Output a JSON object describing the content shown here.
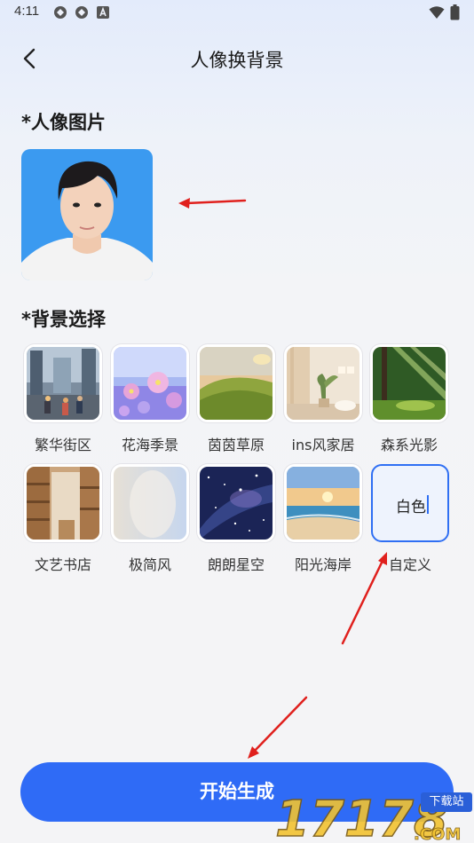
{
  "status_bar": {
    "time": "4:11",
    "icons": [
      "app-icon-1",
      "app-icon-2",
      "a-badge-icon",
      "wifi-icon",
      "battery-icon"
    ]
  },
  "header": {
    "title": "人像换背景",
    "back_icon": "chevron-left-icon"
  },
  "portrait_section": {
    "title": "*人像图片"
  },
  "background_section": {
    "title": "*背景选择",
    "options": [
      {
        "label": "繁华街区",
        "icon": "city-street-thumb"
      },
      {
        "label": "花海季景",
        "icon": "flower-field-thumb"
      },
      {
        "label": "茵茵草原",
        "icon": "grassland-thumb"
      },
      {
        "label": "ins风家居",
        "icon": "ins-home-thumb"
      },
      {
        "label": "森系光影",
        "icon": "forest-light-thumb"
      },
      {
        "label": "文艺书店",
        "icon": "bookstore-thumb"
      },
      {
        "label": "极简风",
        "icon": "minimal-thumb"
      },
      {
        "label": "朗朗星空",
        "icon": "starry-sky-thumb"
      },
      {
        "label": "阳光海岸",
        "icon": "sunny-coast-thumb"
      },
      {
        "label": "自定义",
        "value": "白色",
        "selected": true
      }
    ]
  },
  "generate_button": {
    "label": "开始生成"
  },
  "watermark": {
    "text": "17178",
    "sub": ".COM",
    "badge": "下载站"
  },
  "colors": {
    "accent": "#2f6bf6",
    "annotation": "#e0201d"
  }
}
